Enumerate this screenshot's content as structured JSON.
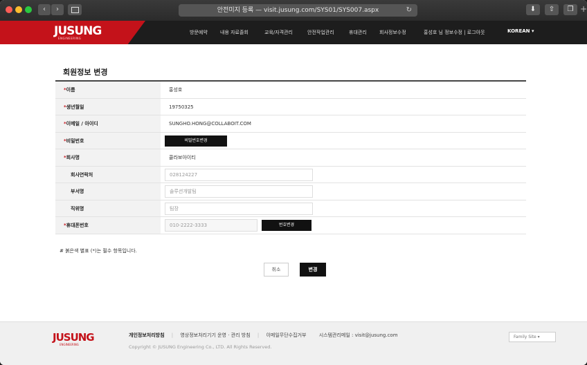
{
  "browser": {
    "url_text": "안전미지 등록 — visit.jusung.com/SYS01/SYS007.aspx",
    "back_glyph": "‹",
    "forward_glyph": "›",
    "reload_glyph": "↻",
    "new_tab_glyph": "+"
  },
  "header": {
    "logo": "JUSUNG",
    "logo_sub": "ENGINEERING",
    "nav": [
      "방문예약",
      "내용 자료졸회",
      "교육/자격관리",
      "안전작업관리",
      "휴대관리",
      "회사정보수정"
    ],
    "user_info": "홍성호 님 정보수정 | 로그아웃",
    "language": "KOREAN ▾"
  },
  "page": {
    "title": "회원정보 변경"
  },
  "form": {
    "name_label": "이름",
    "name_value": "홍성호",
    "birth_label": "생년월일",
    "birth_value": "19750325",
    "email_label": "이메일 / 아이디",
    "email_value": "SUNGHO.HONG@COLLABOIT.COM",
    "password_label": "비밀번호",
    "password_button": "비밀번호변경",
    "company_label": "회사명",
    "company_value": "콜라보아이티",
    "company_phone_label": "회사연락처",
    "company_phone_value": "028124227",
    "department_label": "부서명",
    "department_value": "솔루션개발팀",
    "position_label": "직위명",
    "position_value": "팀장",
    "mobile_label": "휴대폰번호",
    "mobile_value": "010-2222-3333",
    "mobile_button": "번호변경",
    "required_mark": "*"
  },
  "note": "# 붉은색 별표 (*)는 필수 항목입니다.",
  "actions": {
    "cancel": "취소",
    "submit": "변경"
  },
  "footer": {
    "logo": "JUSUNG",
    "logo_sub": "ENGINEERING",
    "privacy": "개인정보처리방침",
    "cctv": "영상정보처리기기 운영 · 관리 방침",
    "email_refusal": "이메일무단수집거부",
    "admin_email": "시스템관리메일 : visit@jusung.com",
    "copyright": "Copyright © JUSUNG Engineering Co., LTD. All Rights Reserved.",
    "family_site": "Family Site ▾"
  }
}
